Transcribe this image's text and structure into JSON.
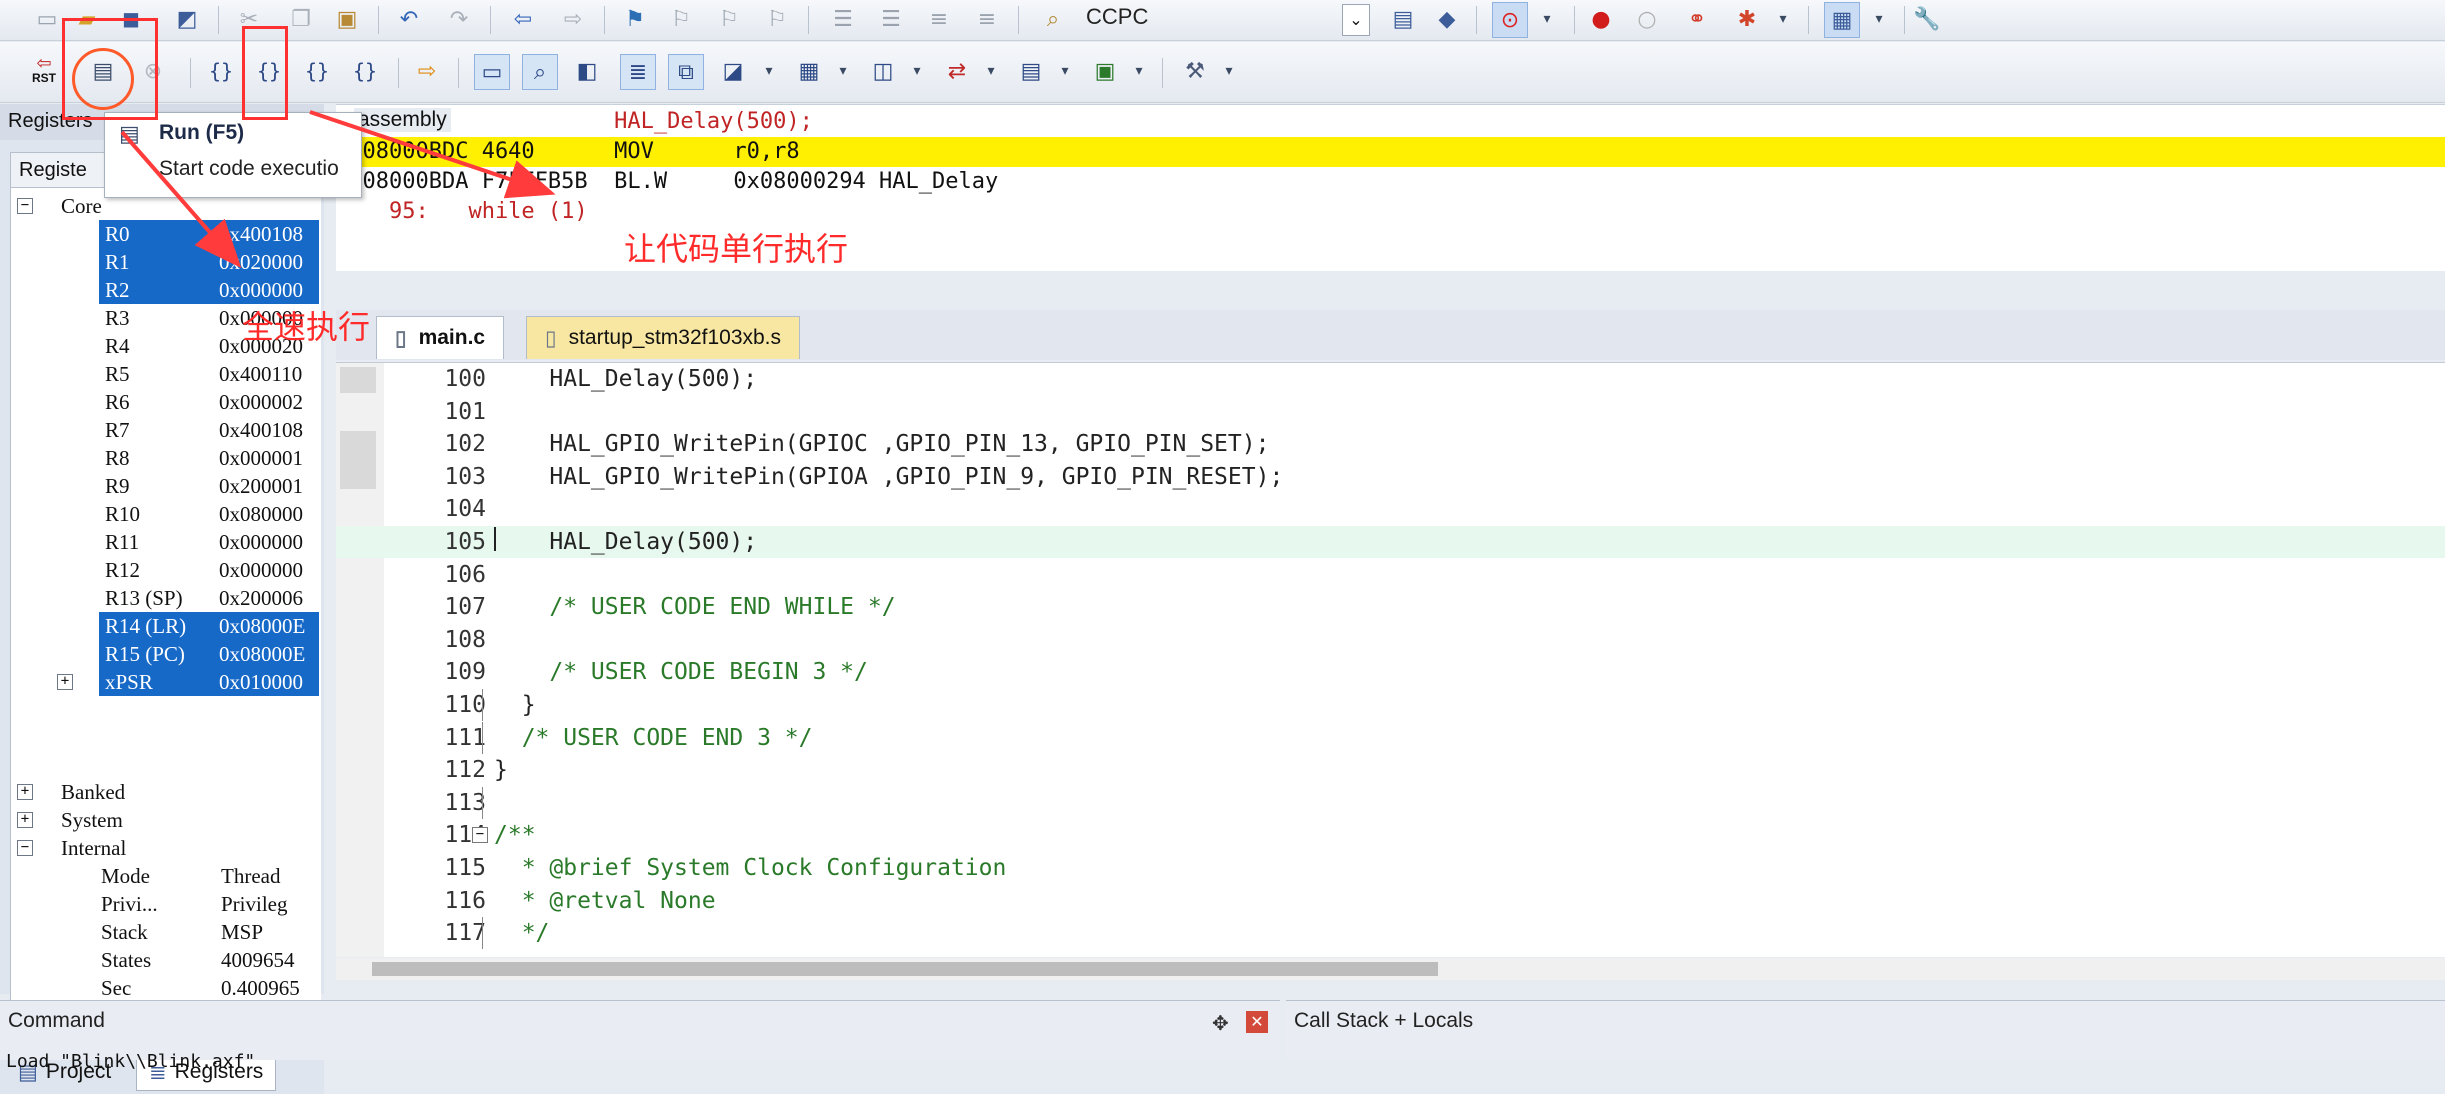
{
  "toolbar1": {
    "target_name": "CCPC",
    "buttons": [
      "new-file-icon",
      "open-folder-icon",
      "save-icon",
      "save-all-icon",
      "cut-icon",
      "copy-icon",
      "paste-icon",
      "undo-icon",
      "redo-icon",
      "back-icon",
      "forward-icon",
      "bookmark-icon",
      "bookmark-prev-icon",
      "bookmark-next-icon",
      "bookmark-clear-icon",
      "indent-icon",
      "unindent-icon",
      "comment-icon",
      "uncomment-icon",
      "find-in-files-icon",
      "target-options-icon",
      "manage-icon",
      "debug-icon",
      "breakpoint-icon",
      "breakpoint-disable-icon",
      "breakpoint-kill-icon",
      "breakpoint-manage-icon",
      "window-layout-icon",
      "tools-icon"
    ]
  },
  "toolbar2": {
    "reset_label": "RST",
    "buttons": [
      "reset-icon",
      "run-icon",
      "stop-icon",
      "step-into-icon",
      "step-over-icon",
      "step-out-icon",
      "run-to-cursor-icon",
      "show-next-statement-icon",
      "command-window-icon",
      "disassembly-window-icon",
      "symbols-window-icon",
      "registers-window-icon",
      "call-stack-window-icon",
      "watch-window-icon",
      "memory-window-icon",
      "serial-window-icon",
      "analysis-window-icon",
      "trace-window-icon",
      "system-viewer-icon",
      "toolbox-icon"
    ]
  },
  "left_panel": {
    "title": "Registers",
    "header": "Registe",
    "core_label": "Core",
    "registers": [
      {
        "name": "R0",
        "value": "0x400108",
        "selected": true
      },
      {
        "name": "R1",
        "value": "0x020000",
        "selected": true
      },
      {
        "name": "R2",
        "value": "0x000000",
        "selected": true
      },
      {
        "name": "R3",
        "value": "0x000000",
        "selected": false
      },
      {
        "name": "R4",
        "value": "0x000020",
        "selected": false
      },
      {
        "name": "R5",
        "value": "0x400110",
        "selected": false
      },
      {
        "name": "R6",
        "value": "0x000002",
        "selected": false
      },
      {
        "name": "R7",
        "value": "0x400108",
        "selected": false
      },
      {
        "name": "R8",
        "value": "0x000001",
        "selected": false
      },
      {
        "name": "R9",
        "value": "0x200001",
        "selected": false
      },
      {
        "name": "R10",
        "value": "0x080000",
        "selected": false
      },
      {
        "name": "R11",
        "value": "0x000000",
        "selected": false
      },
      {
        "name": "R12",
        "value": "0x000000",
        "selected": false
      },
      {
        "name": "R13 (SP)",
        "value": "0x200006",
        "selected": false
      },
      {
        "name": "R14 (LR)",
        "value": "0x08000E",
        "selected": true
      },
      {
        "name": "R15 (PC)",
        "value": "0x08000E",
        "selected": true
      },
      {
        "name": "xPSR",
        "value": "0x010000",
        "selected": true
      }
    ],
    "groups": [
      "Banked",
      "System",
      "Internal"
    ],
    "internal": [
      {
        "name": "Mode",
        "value": "Thread"
      },
      {
        "name": "Privi...",
        "value": "Privileg"
      },
      {
        "name": "Stack",
        "value": "MSP"
      },
      {
        "name": "States",
        "value": "4009654"
      },
      {
        "name": "Sec",
        "value": "0.400965"
      }
    ],
    "tabs": {
      "project": "Project",
      "registers": "Registers"
    }
  },
  "tooltip": {
    "title": "Run (F5)",
    "description": "Start code executio"
  },
  "disassembly": {
    "title": "assembly",
    "lines": [
      {
        "text": "   105:              HAL_Delay(500);",
        "kind": "source"
      },
      {
        "text": "0x08000BDC 4640      MOV      r0,r8",
        "kind": "current"
      },
      {
        "text": "0x08000BDA F7FFFB5B  BL.W     0x08000294 HAL_Delay",
        "kind": "asm"
      },
      {
        "text": "    95:   while (1)",
        "kind": "source"
      }
    ]
  },
  "editor": {
    "tabs": [
      "main.c",
      "startup_stm32f103xb.s"
    ],
    "lines": [
      {
        "num": "100",
        "code": "    HAL_Delay(500);"
      },
      {
        "num": "101",
        "code": ""
      },
      {
        "num": "102",
        "code": "    HAL_GPIO_WritePin(GPIOC ,GPIO_PIN_13, GPIO_PIN_SET);"
      },
      {
        "num": "103",
        "code": "    HAL_GPIO_WritePin(GPIOA ,GPIO_PIN_9, GPIO_PIN_RESET);"
      },
      {
        "num": "104",
        "code": ""
      },
      {
        "num": "105",
        "code": "    HAL_Delay(500);"
      },
      {
        "num": "106",
        "code": ""
      },
      {
        "num": "107",
        "code": "    /* USER CODE END WHILE */"
      },
      {
        "num": "108",
        "code": ""
      },
      {
        "num": "109",
        "code": "    /* USER CODE BEGIN 3 */"
      },
      {
        "num": "110",
        "code": "  }"
      },
      {
        "num": "111",
        "code": "  /* USER CODE END 3 */"
      },
      {
        "num": "112",
        "code": "}"
      },
      {
        "num": "113",
        "code": ""
      },
      {
        "num": "114",
        "code": "/**"
      },
      {
        "num": "115",
        "code": "  * @brief System Clock Configuration"
      },
      {
        "num": "116",
        "code": "  * @retval None"
      },
      {
        "num": "117",
        "code": "  */"
      }
    ],
    "current_line": "105"
  },
  "bottom": {
    "command_title": "Command",
    "command_text": "Load \"Blink\\\\Blink.axf\"",
    "callstack_title": "Call Stack + Locals"
  },
  "annotations": {
    "run_label": "全速执行",
    "step_label": "让代码单行执行"
  },
  "colors": {
    "selection": "#1769c8",
    "current_asm": "#ffef00",
    "annotation": "#ff2a2a"
  }
}
